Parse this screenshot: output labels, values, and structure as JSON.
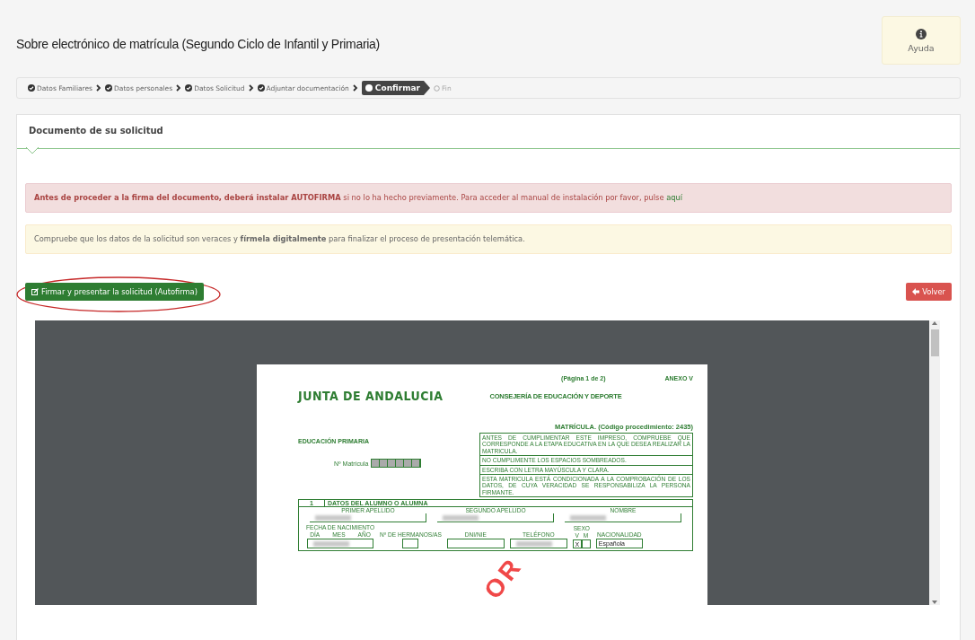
{
  "page_title": "Sobre electrónico de matrícula (Segundo Ciclo de Infantil y Primaria)",
  "help_button": {
    "label": "Ayuda"
  },
  "steps": [
    {
      "label": "Datos Familiares",
      "kind": "done"
    },
    {
      "label": "Datos personales",
      "kind": "done"
    },
    {
      "label": "Datos Solicitud",
      "kind": "done"
    },
    {
      "label": "Adjuntar documentación",
      "kind": "done"
    },
    {
      "label": "Confirmar",
      "kind": "current"
    },
    {
      "label": "Fin",
      "kind": "pending"
    }
  ],
  "panel": {
    "title": "Documento de su solicitud",
    "alerts": [
      {
        "kind": "danger",
        "text": "**Antes de proceder a la firma del documento, deberá instalar AUTOFIRMA** si no lo ha hecho previamente. Para acceder al manual de instalación por favor, pulse",
        "link": "aquí"
      },
      {
        "kind": "warning",
        "text": "Compruebe que los datos de la solicitud son veraces y **fírmela digitalmente** para finalizar el proceso de presentación telemática."
      }
    ],
    "sign_button": {
      "label": "Firmar y presentar la solicitud (Autofirma)",
      "highlighted": true
    },
    "back_button": {
      "label": "Volver"
    }
  },
  "document": {
    "page_number": "(Página 1 de 2)",
    "annex": "ANEXO V",
    "logo": "JUNTA DE ANDALUCIA",
    "department": "CONSEJERÍA DE EDUCACIÓN Y DEPORTE",
    "procedure": "MATRÍCULA. (Código procedimiento: 2435)",
    "stage": "EDUCACIÓN PRIMARIA",
    "enrolment_number_label": "Nº Matrícula",
    "instructions": [
      "ANTES DE CUMPLIMENTAR ESTE IMPRESO, COMPRUEBE QUE CORRESPONDE A LA ETAPA EDUCATIVA EN LA QUE DESEA REALIZAR LA MATRICULA.",
      "NO CUMPLIMENTE LOS ESPACIOS SOMBREADOS.",
      "ESCRIBA CON LETRA MAYÚSCULA Y CLARA.",
      "ESTA MATRICULA ESTÁ CONDICIONADA A LA COMPROBACIÓN DE LOS DATOS, DE CUYA VERACIDAD SE RESPONSABILIZA LA PERSONA FIRMANTE."
    ],
    "section_number": "1",
    "section_title": "DATOS DEL ALUMNO O ALUMNA",
    "name_labels": [
      "PRIMER APELLIDO",
      "SEGUNDO APELLIDO",
      "NOMBRE"
    ],
    "birth_label": "FECHA DE NACIMIENTO",
    "birth_parts": [
      "DÍA",
      "MES",
      "AÑO"
    ],
    "siblings_label": "Nº DE HERMANOS/AS",
    "id_label": "DNI/NIE",
    "phone_label": "TELÉFONO",
    "sex_label": "SEXO",
    "sex_options": [
      {
        "label": "V",
        "checked": true
      },
      {
        "label": "M",
        "checked": false
      }
    ],
    "check_mark": "X",
    "nationality_label": "NACIONALIDAD",
    "nationality": "Española",
    "stamp": "OR"
  }
}
